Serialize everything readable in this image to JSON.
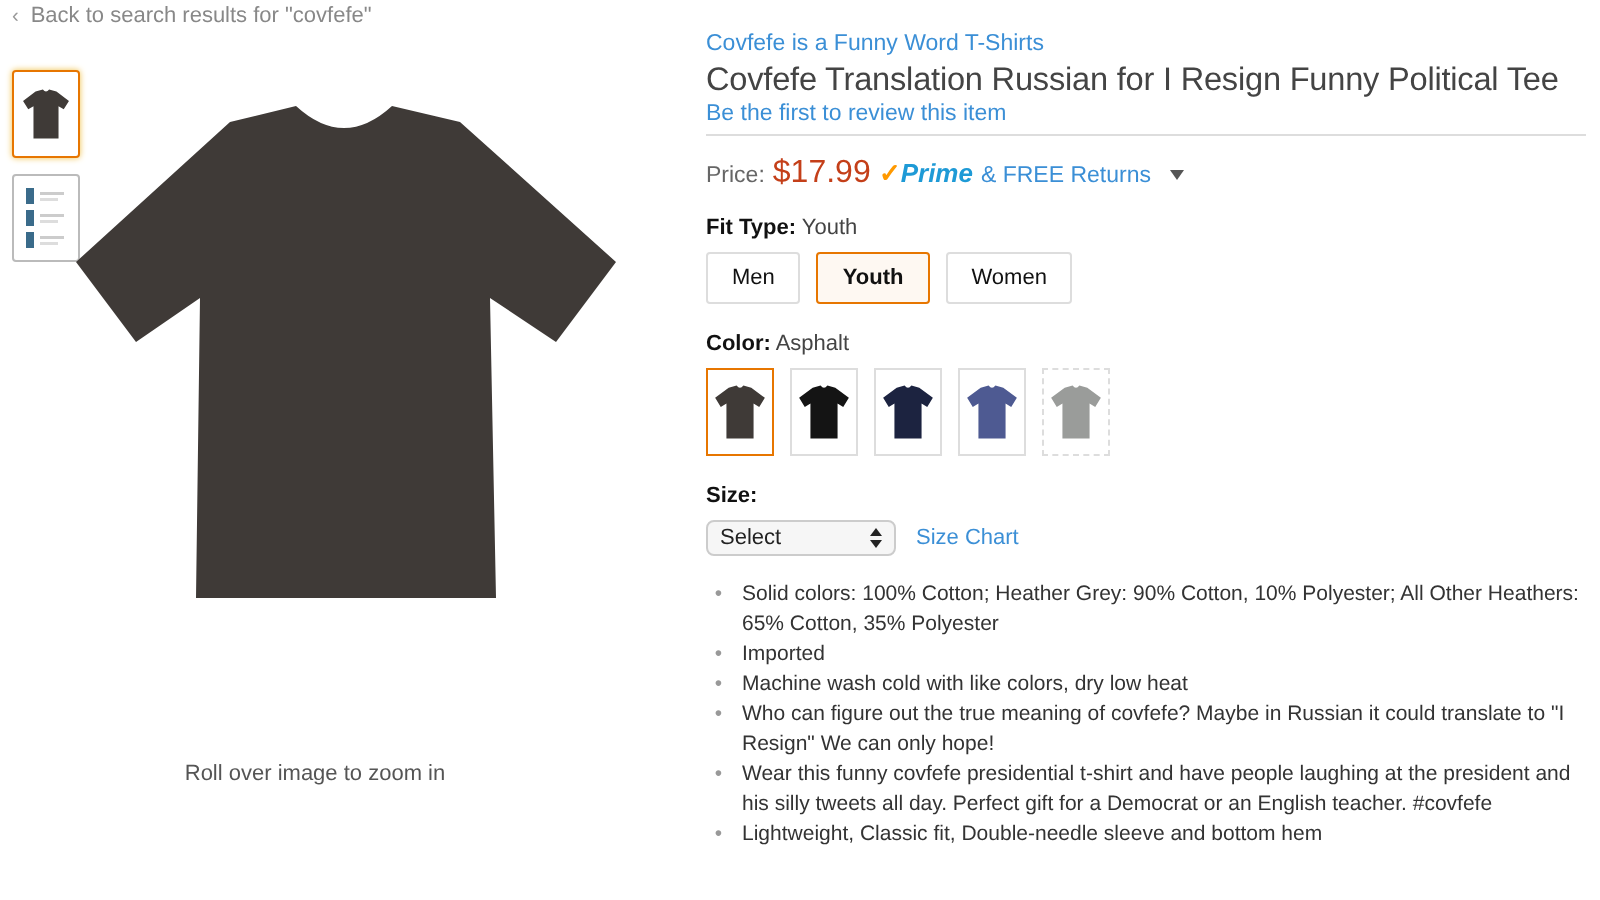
{
  "back_link": {
    "arrow": "‹",
    "label": "Back to search results for \"covfefe\""
  },
  "thumbnails": [
    {
      "kind": "shirt",
      "selected": true
    },
    {
      "kind": "variants",
      "selected": false
    }
  ],
  "zoom_hint": "Roll over image to zoom in",
  "brand": "Covfefe is a Funny Word T-Shirts",
  "title": "Covfefe Translation Russian for I Resign Funny Political Tee",
  "review_link": "Be the first to review this item",
  "price": {
    "label": "Price:",
    "amount": "$17.99",
    "badge_check": "✓",
    "badge": "Prime",
    "returns": "& FREE Returns"
  },
  "fit_type": {
    "label": "Fit Type:",
    "value": "Youth",
    "options": [
      {
        "label": "Men",
        "selected": false
      },
      {
        "label": "Youth",
        "selected": true
      },
      {
        "label": "Women",
        "selected": false
      }
    ]
  },
  "color": {
    "label": "Color:",
    "value": "Asphalt",
    "swatches": [
      {
        "color": "#3f3a37",
        "selected": true,
        "available": true
      },
      {
        "color": "#141414",
        "selected": false,
        "available": true
      },
      {
        "color": "#1c2340",
        "selected": false,
        "available": true
      },
      {
        "color": "#4e5a92",
        "selected": false,
        "available": true
      },
      {
        "color": "#9a9c9a",
        "selected": false,
        "available": false
      }
    ]
  },
  "size": {
    "label": "Size:",
    "value": "Select",
    "chart_link": "Size Chart"
  },
  "features": [
    {
      "bullet": "•",
      "text": "Solid colors: 100% Cotton; Heather Grey: 90% Cotton, 10% Polyester; All Other Heathers: 65% Cotton, 35% Polyester"
    },
    {
      "bullet": "•",
      "text": "Imported"
    },
    {
      "bullet": "•",
      "text": "Machine wash cold with like colors, dry low heat"
    },
    {
      "bullet": "•",
      "text": "Who can figure out the true meaning of covfefe? Maybe in Russian it could translate to \"I Resign\" We can only hope!"
    },
    {
      "bullet": "•",
      "text": "Wear this funny covfefe presidential t-shirt and have people laughing at the president and his silly tweets all day. Perfect gift for a Democrat or an English teacher. #covfefe"
    },
    {
      "bullet": "•",
      "text": "Lightweight, Classic fit, Double-needle sleeve and bottom hem"
    }
  ]
}
